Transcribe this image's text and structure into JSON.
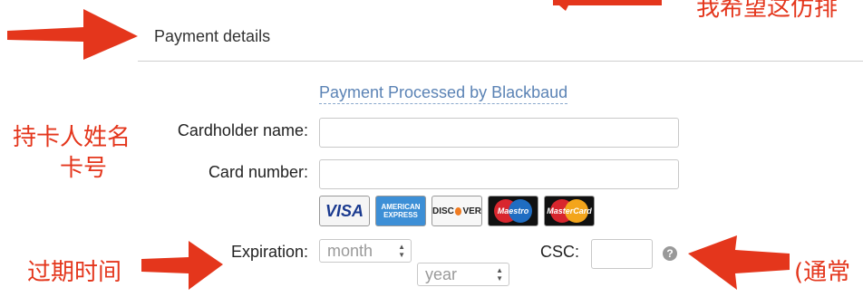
{
  "form": {
    "section_title": "Payment details",
    "processed_by": "Payment Processed by Blackbaud",
    "cardholder_label": "Cardholder name:",
    "cardholder_value": "",
    "card_number_label": "Card number:",
    "card_number_value": "",
    "expiration_label": "Expiration:",
    "month_placeholder": "month",
    "year_placeholder": "year",
    "csc_label": "CSC:",
    "csc_value": "",
    "help_glyph": "?"
  },
  "cards": {
    "visa": "VISA",
    "amex_line1": "AMERICAN",
    "amex_line2": "EXPRESS",
    "discover_a": "DISC",
    "discover_b": "VER",
    "maestro": "Maestro",
    "mastercard": "MasterCard"
  },
  "annotations": {
    "top_right": "我希望这仿排",
    "cardholder_cn": "持卡人姓名",
    "card_number_cn": "卡号",
    "expiration_cn": "过期时间",
    "csc_cn": "(通常"
  },
  "colors": {
    "annotation_red": "#e4361c",
    "link_blue": "#5b83b5"
  }
}
